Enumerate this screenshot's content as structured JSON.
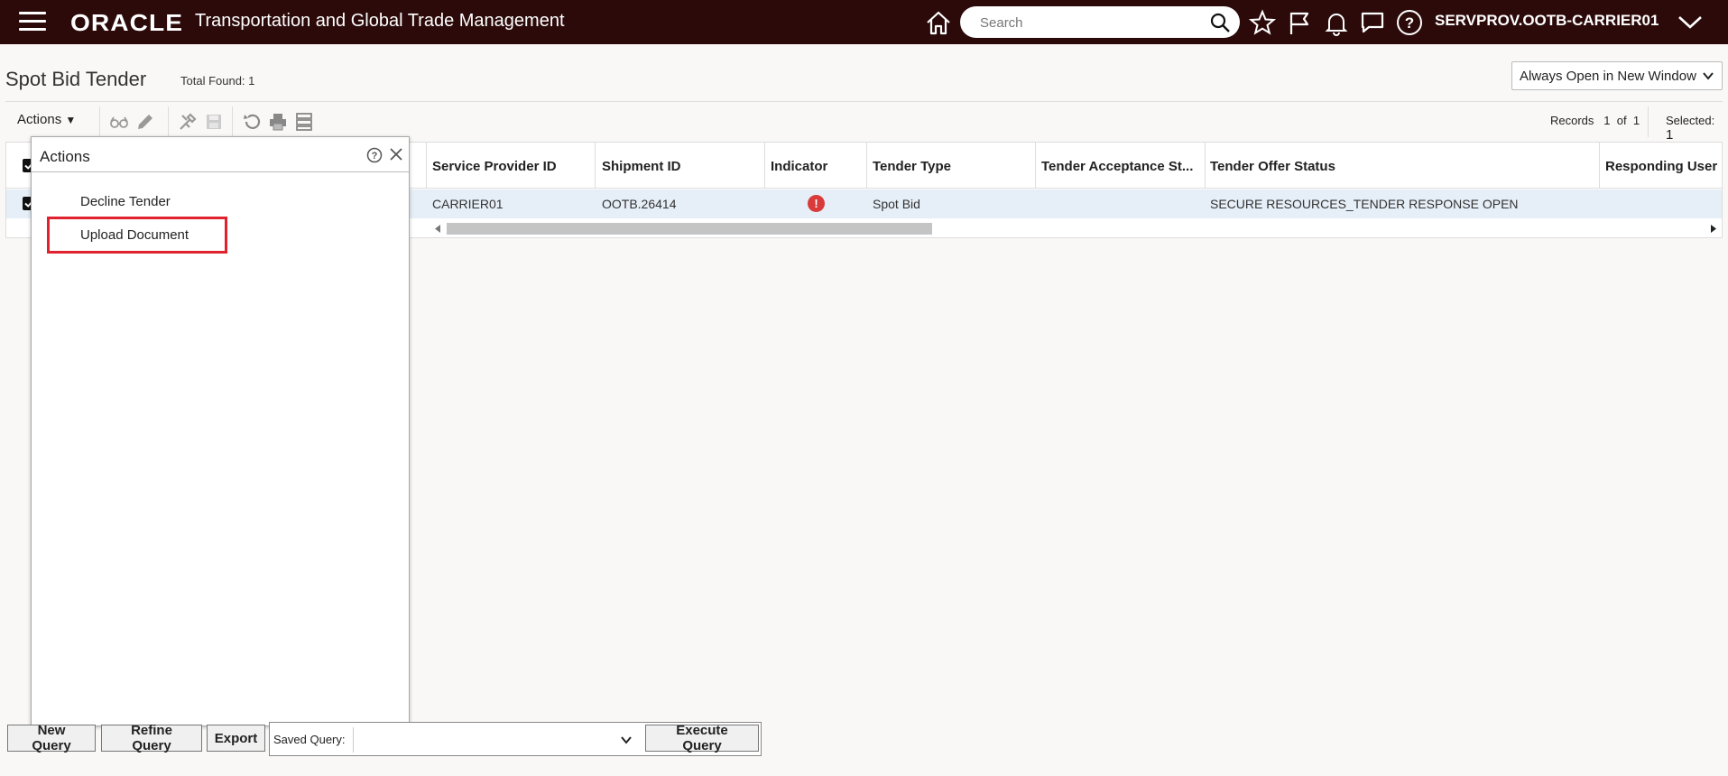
{
  "header": {
    "logo": "ORACLE",
    "app_title": "Transportation and Global Trade Management",
    "search_placeholder": "Search",
    "user": "SERVPROV.OOTB-CARRIER01",
    "icons": [
      "menu-icon",
      "home-icon",
      "search-icon",
      "favorites-icon",
      "flag-icon",
      "notification-icon",
      "chat-icon",
      "help-icon",
      "chevron-down-icon"
    ]
  },
  "page": {
    "title": "Spot Bid Tender",
    "total_found_label": "Total Found:",
    "total_found_value": "1",
    "open_mode": "Always Open in New Window"
  },
  "toolbar": {
    "actions_label": "Actions",
    "records_label": "Records",
    "records_current": "1",
    "records_of": "of",
    "records_total": "1",
    "selected_label": "Selected:",
    "selected_value": "1"
  },
  "grid": {
    "columns": [
      "Service Provider ID",
      "Shipment ID",
      "Indicator",
      "Tender Type",
      "Tender Acceptance St...",
      "Tender Offer Status",
      "Responding User"
    ],
    "rows": [
      {
        "service_provider_id": "CARRIER01",
        "shipment_id": "OOTB.26414",
        "indicator": "!",
        "tender_type": "Spot Bid",
        "tender_acceptance_status": "",
        "tender_offer_status": "SECURE RESOURCES_TENDER RESPONSE OPEN",
        "responding_user": ""
      }
    ]
  },
  "actions_popup": {
    "title": "Actions",
    "items": [
      "Decline Tender",
      "Upload Document"
    ]
  },
  "footer": {
    "new_query": "New Query",
    "refine_query": "Refine Query",
    "export": "Export",
    "saved_query_label": "Saved Query:",
    "saved_query_value": "",
    "execute_query": "Execute Query"
  },
  "colors": {
    "header_bg": "#2c0a0a",
    "selected_row_bg": "#e6eef7",
    "highlight": "#e0222e",
    "indicator_red": "#d93a3a"
  }
}
